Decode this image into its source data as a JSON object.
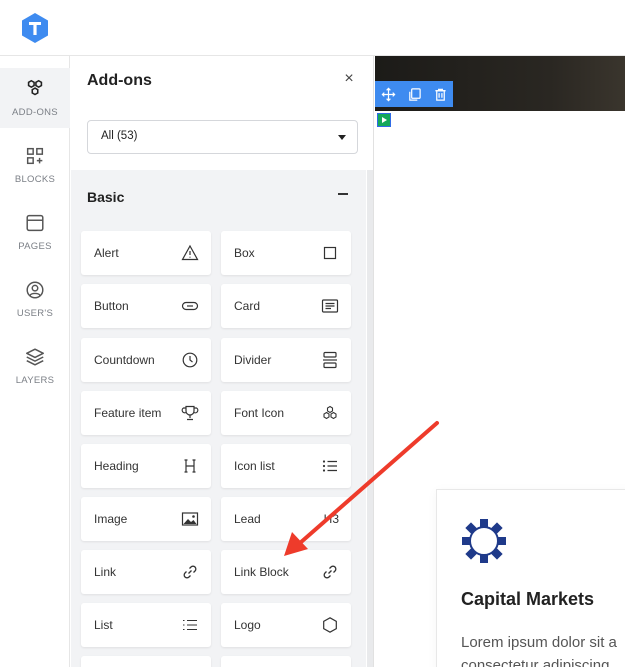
{
  "rail": {
    "items": [
      {
        "label": "ADD-ONS",
        "icon": "addons-icon",
        "active": true
      },
      {
        "label": "BLOCKS",
        "icon": "blocks-icon"
      },
      {
        "label": "PAGES",
        "icon": "pages-icon"
      },
      {
        "label": "USER'S",
        "icon": "user-icon"
      },
      {
        "label": "LAYERS",
        "icon": "layers-icon"
      }
    ]
  },
  "panel": {
    "title": "Add-ons",
    "close": "×",
    "filter_value": "All (53)",
    "group_title": "Basic",
    "tiles": [
      {
        "label": "Alert",
        "icon": "warning-icon"
      },
      {
        "label": "Box",
        "icon": "square-icon"
      },
      {
        "label": "Button",
        "icon": "button-icon"
      },
      {
        "label": "Card",
        "icon": "card-icon"
      },
      {
        "label": "Countdown",
        "icon": "clock-icon"
      },
      {
        "label": "Divider",
        "icon": "divider-icon"
      },
      {
        "label": "Feature item",
        "icon": "trophy-icon"
      },
      {
        "label": "Font Icon",
        "icon": "font-icon-icon"
      },
      {
        "label": "Heading",
        "icon": "heading-icon"
      },
      {
        "label": "Icon list",
        "icon": "icon-list-icon"
      },
      {
        "label": "Image",
        "icon": "image-icon"
      },
      {
        "label": "Lead",
        "icon": "lead-icon"
      },
      {
        "label": "Link",
        "icon": "link-icon"
      },
      {
        "label": "Link Block",
        "icon": "link-icon"
      },
      {
        "label": "List",
        "icon": "list-icon"
      },
      {
        "label": "Logo",
        "icon": "hexagon-icon"
      }
    ]
  },
  "canvas": {
    "card": {
      "title": "Capital Markets",
      "body_line1": "Lorem ipsum dolor sit a",
      "body_line2": "consectetur adipiscing"
    },
    "lead_icon_text": "H3"
  },
  "colors": {
    "accent": "#3e8bf0",
    "annotation_arrow": "#ee3b2b",
    "card_icon": "#1f3a8a",
    "panel_group_bg": "#f2f3f5"
  }
}
